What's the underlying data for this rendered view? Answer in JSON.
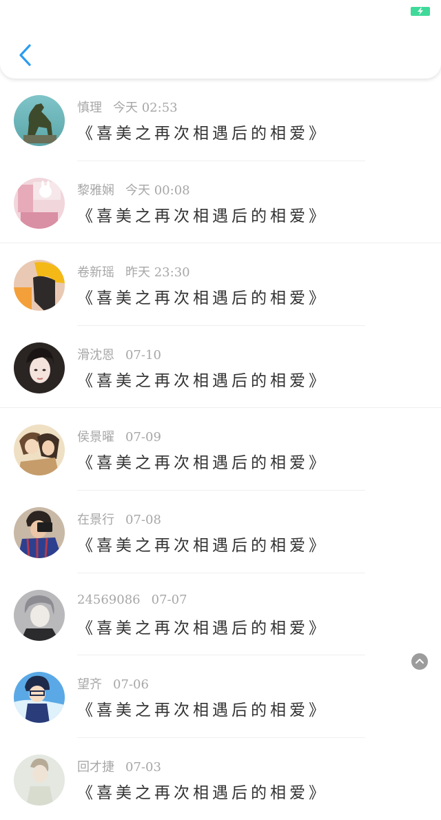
{
  "header": {
    "back_icon": "chevron-left-icon",
    "accent": "#2a9cf0",
    "battery_color": "#3fd99a"
  },
  "items": [
    {
      "name": "慎理",
      "time": "今天 02:53",
      "title": "《喜美之再次相遇后的相爱》",
      "avatar_icon": "dog-statue-avatar"
    },
    {
      "name": "黎雅娴",
      "time": "今天 00:08",
      "title": "《喜美之再次相遇后的相爱》",
      "avatar_icon": "pink-shop-avatar"
    },
    {
      "name": "卷新瑶",
      "time": "昨天 23:30",
      "title": "《喜美之再次相遇后的相爱》",
      "avatar_icon": "girl-yellow-hat-avatar"
    },
    {
      "name": "滑沈恩",
      "time": "07-10",
      "title": "《喜美之再次相遇后的相爱》",
      "avatar_icon": "girl-dark-avatar"
    },
    {
      "name": "侯景曜",
      "time": "07-09",
      "title": "《喜美之再次相遇后的相爱》",
      "avatar_icon": "anime-couple-avatar"
    },
    {
      "name": "在景行",
      "time": "07-08",
      "title": "《喜美之再次相遇后的相爱》",
      "avatar_icon": "boy-camera-avatar"
    },
    {
      "name": "24569086",
      "time": "07-07",
      "title": "《喜美之再次相遇后的相爱》",
      "avatar_icon": "anime-boy-gray-avatar"
    },
    {
      "name": "望齐",
      "time": "07-06",
      "title": "《喜美之再次相遇后的相爱》",
      "avatar_icon": "conan-avatar"
    },
    {
      "name": "回才捷",
      "time": "07-03",
      "title": "《喜美之再次相遇后的相爱》",
      "avatar_icon": "person-light-avatar"
    }
  ],
  "floating_button_icon": "chevron-up-icon"
}
